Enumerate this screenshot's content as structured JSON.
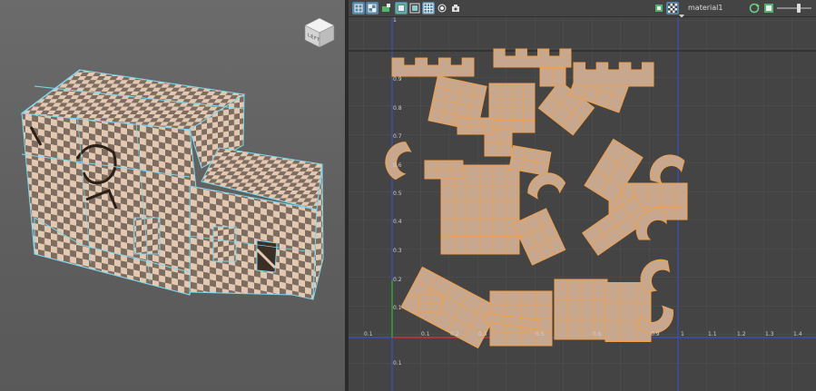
{
  "viewport3d": {
    "view_cube_label": "LEFT"
  },
  "uv_editor": {
    "toolbar": {
      "material_name": "material1"
    },
    "axis_labels": {
      "u": [
        "0.1",
        "0.1",
        "0.2",
        "0.3",
        "0.5",
        "0.6",
        "0.9",
        "1",
        "1.1",
        "1.2",
        "1.3",
        "1.4"
      ],
      "v": [
        "1",
        "0.9",
        "0.8",
        "0.7",
        "0.6",
        "0.5",
        "0.4",
        "0.3",
        "0.2",
        "0.1"
      ],
      "v_below": "0.1"
    },
    "colors": {
      "uv_shell": "#c7a88e",
      "uv_edge": "#f2a04a",
      "u_axis": "#c83232",
      "v_axis": "#2fa52f",
      "grid_border": "#3a4fc7",
      "toolbar_active": "#5285a6"
    }
  }
}
